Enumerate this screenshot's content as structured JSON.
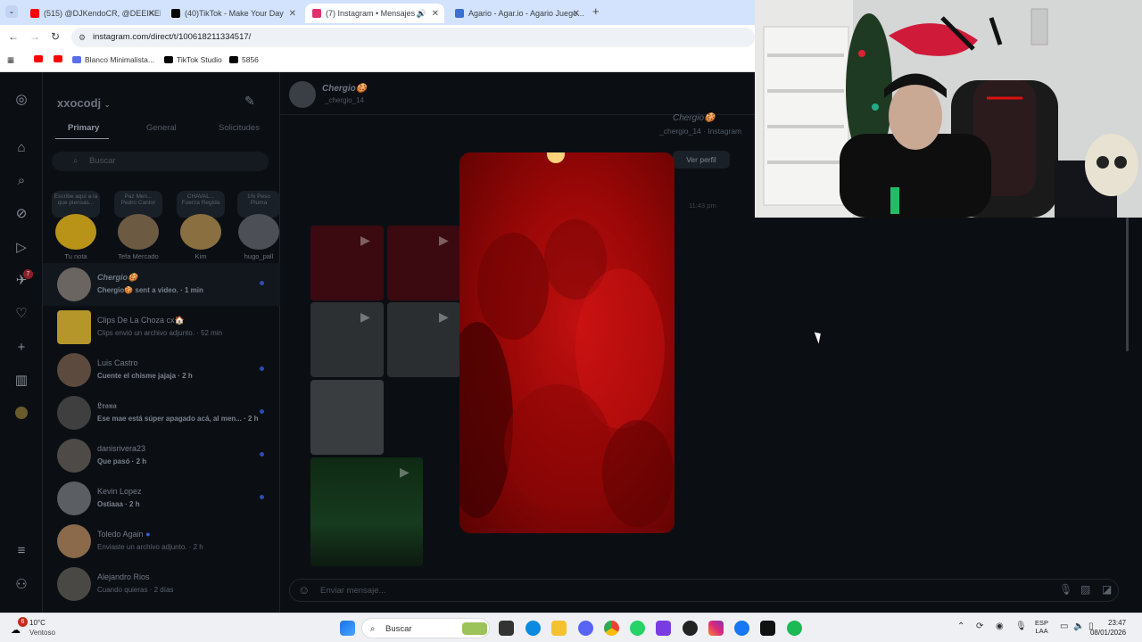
{
  "browser": {
    "tabs": [
      {
        "label": "(515) @DJKendoCR, @DEEIKEL...",
        "icon": "youtube-icon",
        "color": "#ff0000"
      },
      {
        "label": "(40)TikTok - Make Your Day",
        "icon": "tiktok-icon",
        "color": "#000000"
      },
      {
        "label": "(7) Instagram • Mensajes",
        "icon": "instagram-icon",
        "color": "#e1306c"
      },
      {
        "label": "Agario - Agar.io - Agario Juego...",
        "icon": "agario-icon",
        "color": "#3b6fd1"
      }
    ],
    "new_tab": "+",
    "url": "instagram.com/direct/t/100618211334517/",
    "bookmarks": [
      "Blanco Minimalista...",
      "TikTok Studio",
      "5856"
    ]
  },
  "sidebar_rail": {
    "icons": [
      "instagram-icon",
      "home-icon",
      "search-icon",
      "explore-icon",
      "reels-icon",
      "messages-icon",
      "notifications-icon",
      "create-icon",
      "dashboard-icon",
      "profile-icon",
      "menu-icon",
      "threads-icon"
    ],
    "messages_badge": "7"
  },
  "inbox": {
    "account": "xxocodj",
    "tabs": [
      "Primary",
      "General",
      "Solicitudes"
    ],
    "search_placeholder": "Buscar",
    "notes": [
      {
        "bubble": "Escribe aquí a la que piensas...",
        "name": "Tu nota",
        "color": "#b89318"
      },
      {
        "bubble": "Paz Men... Pedro Cantor",
        "name": "Tefa Mercado",
        "color": "#6c5a43"
      },
      {
        "bubble": "CHAVAL... Fuerza Regida",
        "name": "Kim",
        "color": "#8a7040"
      },
      {
        "bubble": "1% Peso Pluma",
        "name": "hugo_pall",
        "color": "#4c4f55"
      }
    ],
    "conversations": [
      {
        "name": "Chergio🍪",
        "message": "Chergio🍪 sent a video. · 1 min",
        "unread": true,
        "selected": true,
        "color": "#6a6560"
      },
      {
        "name": "Clips De La Choza cx🏠",
        "message": "Clips envió un archivo adjunto. · 52 min",
        "unread": false,
        "selected": false,
        "color": "#b5962a"
      },
      {
        "name": "Luis Castro",
        "message": "Cuente el chisme jajaja · 2 h",
        "unread": true,
        "selected": false,
        "color": "#5c4a3f"
      },
      {
        "name": "𝕷𝖗𝖆𝖓𝖆",
        "message": "Ese mae está súper apagado acá, al men... · 2 h",
        "unread": true,
        "selected": false,
        "color": "#3f3f3f"
      },
      {
        "name": "danisrivera23",
        "message": "Que pasó · 2 h",
        "unread": true,
        "selected": false,
        "color": "#4e4a47"
      },
      {
        "name": "Kevin Lopez",
        "message": "Ostiaaa · 2 h",
        "unread": true,
        "selected": false,
        "color": "#5b5e63"
      },
      {
        "name": "Toledo Again",
        "message": "Enviaste un archivo adjunto. · 2 h",
        "unread": false,
        "selected": false,
        "color": "#8a6a4a"
      },
      {
        "name": "Alejandro Rios",
        "message": "Cuando quieras · 2 días",
        "unread": false,
        "selected": false,
        "color": "#4a4845"
      }
    ]
  },
  "chat": {
    "name": "Chergio🍪",
    "username": "_chergio_14",
    "profile_name": "Chergio🍪",
    "profile_sub": "_chergio_14 · Instagram",
    "view_profile": "Ver perfil",
    "timestamp": "11:43 pm",
    "composer_placeholder": "Enviar mensaje..."
  },
  "taskbar": {
    "weather_temp": "10°C",
    "weather_desc": "Ventoso",
    "weather_badge": "6",
    "search_label": "Buscar",
    "lang_top": "ESP",
    "lang_bottom": "LAA",
    "time": "23:47",
    "date": "08/01/2026"
  }
}
